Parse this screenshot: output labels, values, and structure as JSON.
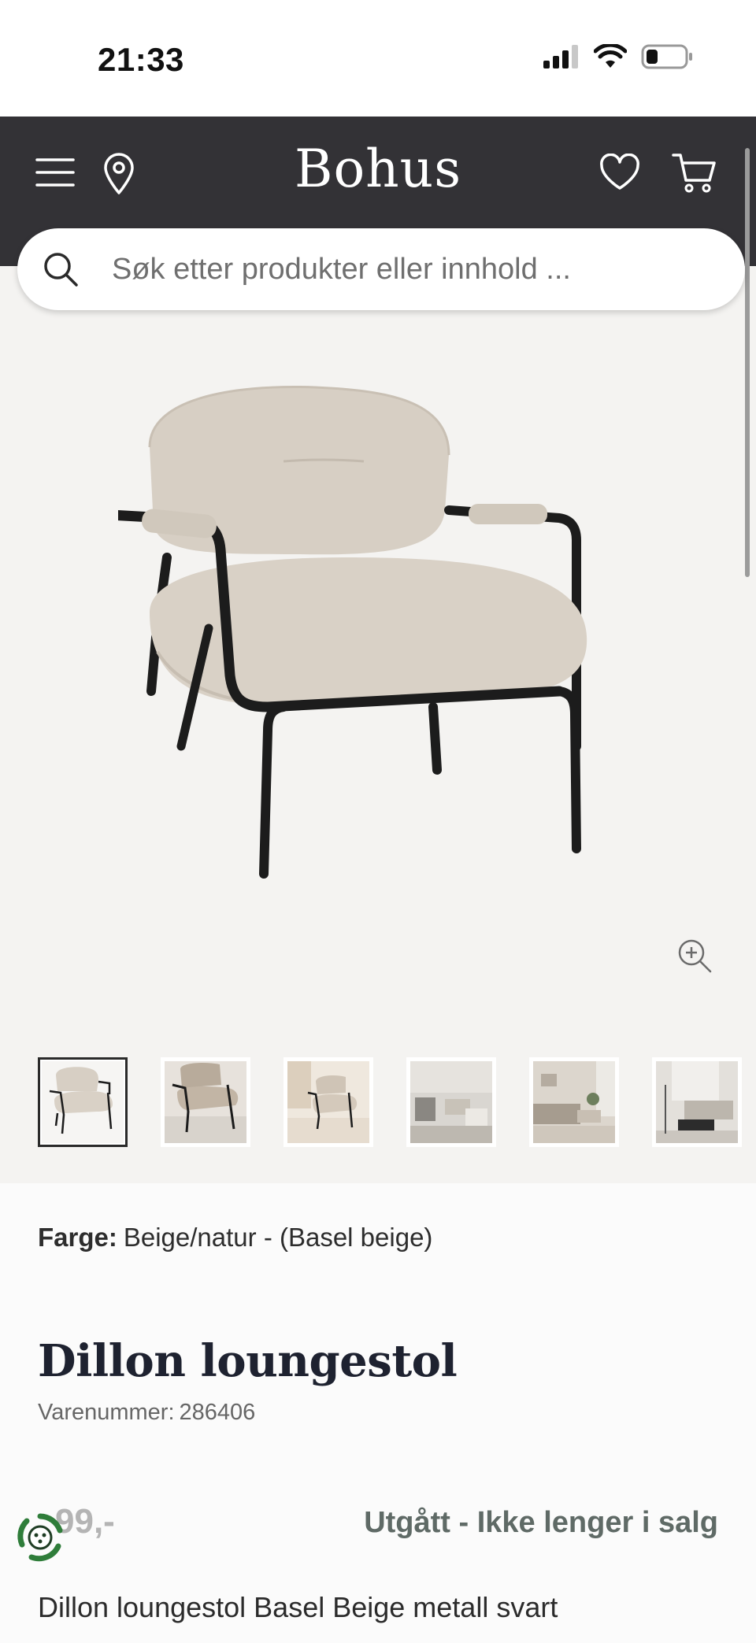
{
  "status_bar": {
    "time": "21:33"
  },
  "header": {
    "logo": "Bohus",
    "search_placeholder": "Søk etter produkter eller innhold ..."
  },
  "gallery": {
    "thumbnail_count": 6,
    "active_index": 0
  },
  "product": {
    "color_label": "Farge:",
    "color_value": "Beige/natur - (Basel beige)",
    "title": "Dillon loungestol",
    "sku_label": "Varenummer:",
    "sku_value": "286406",
    "price": "99,-",
    "availability": "Utgått - Ikke lenger i salg",
    "description": "Dillon loungestol Basel Beige metall svart"
  },
  "colors": {
    "header_bg": "#333236",
    "product_bg": "#f4f3f1",
    "fabric": "#d7cfc4",
    "availability": "#5f6a66",
    "eco_green": "#2f7d3a"
  }
}
